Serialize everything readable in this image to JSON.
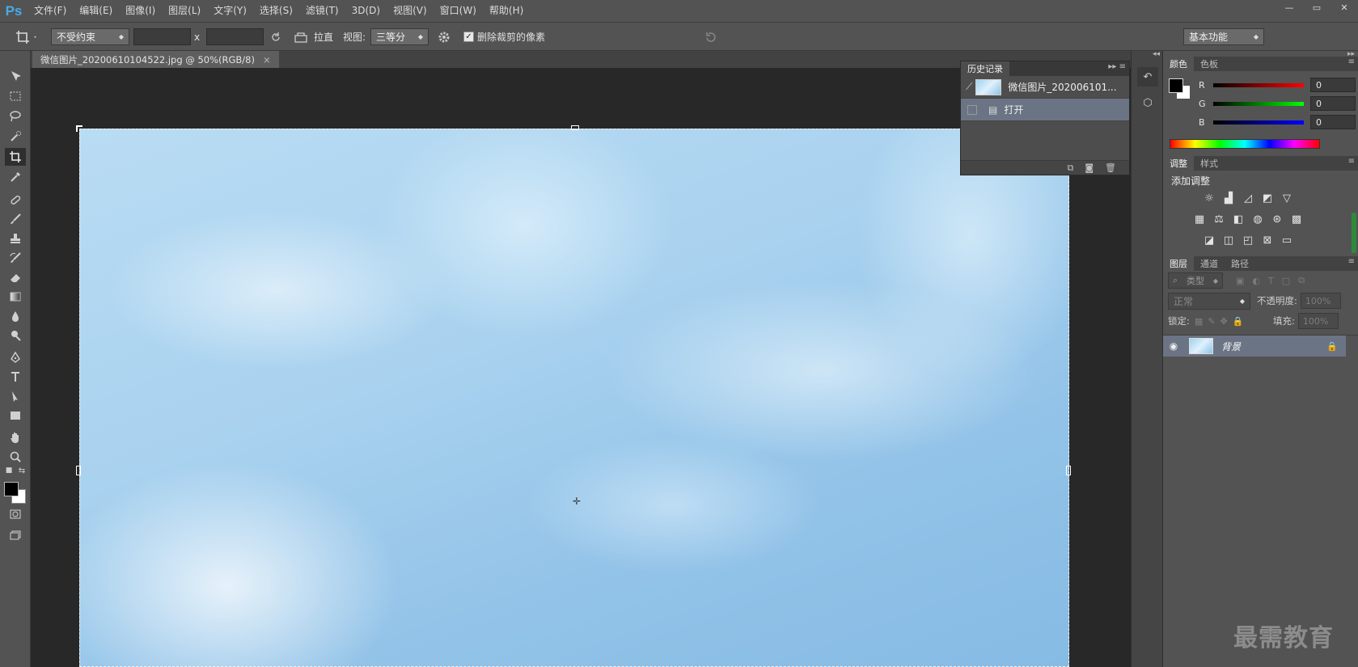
{
  "app": {
    "logo": "Ps",
    "menu": [
      "文件(F)",
      "编辑(E)",
      "图像(I)",
      "图层(L)",
      "文字(Y)",
      "选择(S)",
      "滤镜(T)",
      "3D(D)",
      "视图(V)",
      "窗口(W)",
      "帮助(H)"
    ],
    "window_controls": [
      "—",
      "▭",
      "✕"
    ]
  },
  "options_bar": {
    "ratio_select": "不受约束",
    "width_value": "",
    "height_value": "",
    "separator": "x",
    "straighten_label": "拉直",
    "view_label": "视图:",
    "view_select": "三等分",
    "delete_pixels_label": "删除裁剪的像素",
    "delete_pixels_checked": true,
    "workspace_select": "基本功能"
  },
  "document": {
    "tab_title": "微信图片_20200610104522.jpg @ 50%(RGB/8)",
    "tab_close": "×"
  },
  "history_panel": {
    "tab": "历史记录",
    "snapshot_label": "微信图片_202006101...",
    "steps": [
      "打开"
    ]
  },
  "color_panel": {
    "tabs": [
      "颜色",
      "色板"
    ],
    "channels": [
      {
        "label": "R",
        "value": "0"
      },
      {
        "label": "G",
        "value": "0"
      },
      {
        "label": "B",
        "value": "0"
      }
    ]
  },
  "adjust_panel": {
    "tabs": [
      "调整",
      "样式"
    ],
    "heading": "添加调整"
  },
  "layers_panel": {
    "tabs": [
      "图层",
      "通道",
      "路径"
    ],
    "filter_type": "类型",
    "blend_mode": "正常",
    "opacity_label": "不透明度:",
    "opacity_value": "100%",
    "lock_label": "锁定:",
    "fill_label": "填充:",
    "fill_value": "100%",
    "layers": [
      {
        "name": "背景",
        "visible": true,
        "locked": true
      }
    ]
  },
  "watermark": "最需教育"
}
